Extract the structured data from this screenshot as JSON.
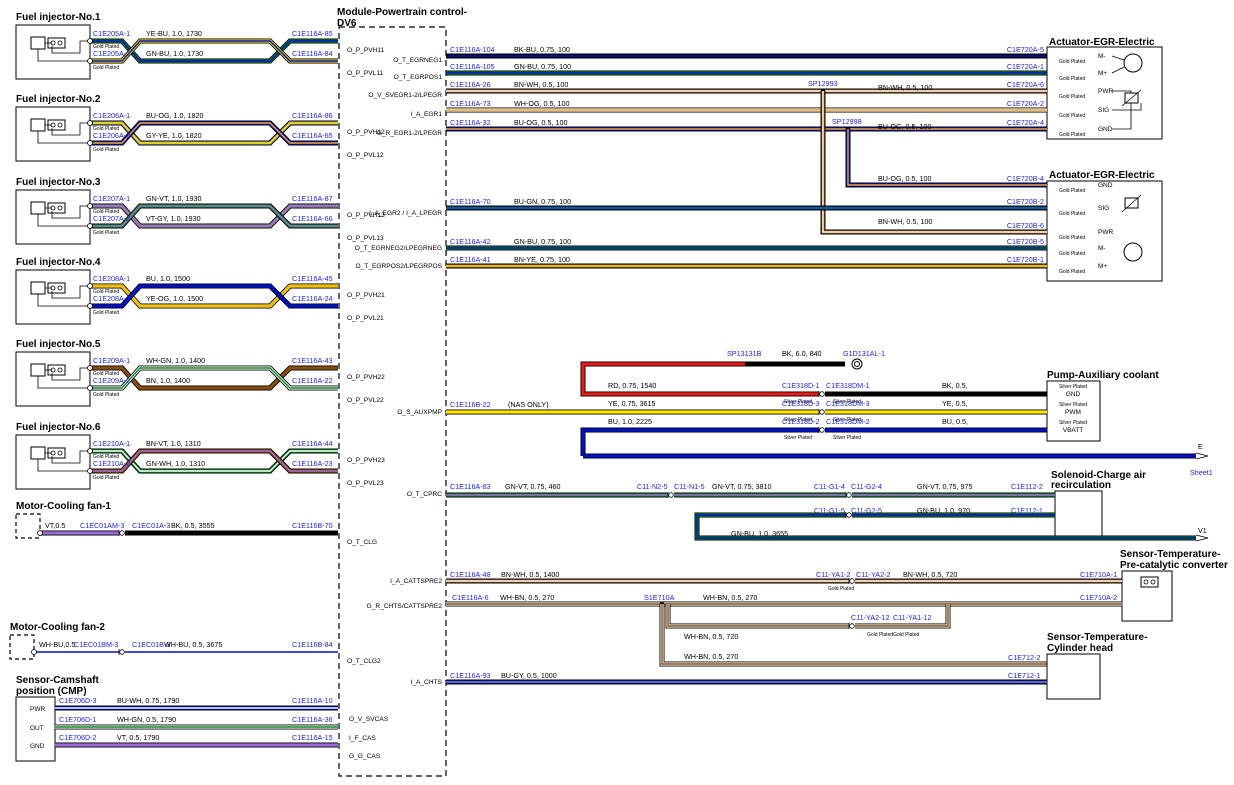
{
  "module": {
    "title": "Module-Powertrain control-DV6"
  },
  "colors": {
    "connector_text": "#1f1fd6",
    "BK": "#000000",
    "YE": "#ffe600",
    "BU": "#0010c8",
    "GN": "#0a8a25",
    "WH": "#ffffff",
    "OG": "#f5a623",
    "GY": "#8a8a8a",
    "VT": "#a06ad8",
    "BN": "#8a4d0c",
    "RD": "#e81b1b"
  },
  "plating": {
    "gold": "Gold Plated",
    "silver": "Silver Plated",
    "gold_gold": "Gold PlatedGold Plated"
  },
  "injectors": [
    {
      "title": "Fuel injector-No.1",
      "c1": "C1E205A-1",
      "c2": "C1E205A-2",
      "w1": "YE-BU,  1.0,  1730",
      "w2": "GN-BU,  1.0,  1730",
      "m1": "C1E116A-85",
      "m2": "C1E116A-84",
      "s1": "O_P_PVH11",
      "s2": "O_P_PVL11"
    },
    {
      "title": "Fuel injector-No.2",
      "c1": "C1E206A-1",
      "c2": "C1E206A-2",
      "w1": "BU-OG,  1.0,  1820",
      "w2": "GY-YE,  1.0,  1820",
      "m1": "C1E116A-86",
      "m2": "C1E116A-65",
      "s1": "O_P_PVH12",
      "s2": "O_P_PVL12"
    },
    {
      "title": "Fuel injector-No.3",
      "c1": "C1E207A-1",
      "c2": "C1E207A-2",
      "w1": "GN-VT,  1.0,  1930",
      "w2": "VT-GY,  1.0,  1930",
      "m1": "C1E116A-87",
      "m2": "C1E116A-66",
      "s1": "O_P_PVH13",
      "s2": "O_P_PVL13"
    },
    {
      "title": "Fuel injector-No.4",
      "c1": "C1E208A-1",
      "c2": "C1E208A-2",
      "w1": "BU,  1.0,  1500",
      "w2": "YE-OG,  1.0,  1500",
      "m1": "C1E116A-45",
      "m2": "C1E116A-24",
      "s1": "O_P_PVH21",
      "s2": "O_P_PVL21"
    },
    {
      "title": "Fuel injector-No.5",
      "c1": "C1E209A-1",
      "c2": "C1E209A-2",
      "w1": "WH-GN,  1.0,  1400",
      "w2": "BN,  1.0,  1400",
      "m1": "C1E116A-43",
      "m2": "C1E116A-22",
      "s1": "O_P_PVH22",
      "s2": "O_P_PVL22"
    },
    {
      "title": "Fuel injector-No.6",
      "c1": "C1E210A-1",
      "c2": "C1E210A-2",
      "w1": "BN-VT,  1.0,  1310",
      "w2": "GN-WH,  1.0,  1310",
      "m1": "C1E116A-44",
      "m2": "C1E116A-23",
      "s1": "O_P_PVH23",
      "s2": "O_P_PVL23"
    }
  ],
  "fan1": {
    "title": "Motor-Cooling fan-1",
    "pre": "VT,0.5",
    "c_a": "C1EC01AM-3",
    "c_b": "C1EC01A-3",
    "wire": "BK,  0.5,  3555",
    "m": "C1E116B-70",
    "sig": "O_T_CLG"
  },
  "fan2": {
    "title": "Motor-Cooling fan-2",
    "pre": "WH-BU,0.5",
    "c_a": "C1EC01BM-3",
    "c_b": "C1EC01B-3",
    "wire": "WH-BU,  0.5,  3675",
    "m": "C1E116B-84",
    "sig": "O_T_CLG2"
  },
  "cmp": {
    "title1": "Sensor-Camshaft",
    "title2": "position (CMP)",
    "pins": [
      "PWR",
      "OUT",
      "GND"
    ],
    "rows": [
      {
        "c": "C1E706D-3",
        "w": "BU-WH,  0.75,  1790",
        "m": "C1E116A-10",
        "s": "O_V_SVCAS"
      },
      {
        "c": "C1E706D-1",
        "w": "WH-GN,  0.5,  1790",
        "m": "C1E116A-36",
        "s": "I_F_CAS"
      },
      {
        "c": "C1E706D-2",
        "w": "VT,  0.5,  1790",
        "m": "C1E116A-15",
        "s": "G_G_CAS"
      }
    ]
  },
  "egr1": {
    "title": "Actuator-EGR-Electric",
    "pins": [
      "M-",
      "M+",
      "PWR",
      "SIG",
      "GND"
    ],
    "rows": [
      {
        "m": "C1E116A-104",
        "s": "O_T_EGRNEG1",
        "w": "BK-BU,  0.75,  100",
        "c": "C1E720A-5"
      },
      {
        "m": "C1E116A-105",
        "s": "O_T_EGRPOS1",
        "w": "GN-BU,  0.75,  100",
        "c": "C1E720A-1"
      },
      {
        "m": "C1E116A-26",
        "s": "O_V_SVEGR1-2/LPEGR",
        "w": "BN-WH,  0.5,  100",
        "c": "C1E720A-6"
      },
      {
        "m": "C1E116A-73",
        "s": "I_A_EGR1",
        "w": "WH-OG,  0.5,  100",
        "c": "C1E720A-2"
      },
      {
        "m": "C1E116A-32",
        "s": "G_R_EGR1-2/LPEGR",
        "w": "BU-OG,  0.5,  100",
        "c": "C1E720A-4"
      }
    ],
    "splice1": "SP12993",
    "splice2": "SP12998",
    "w_sp1": "BN-WH,  0.5,  100",
    "w_sp2": "BU-OG,  0.5,  100"
  },
  "egr2": {
    "title": "Actuator-EGR-Electric",
    "pins": [
      "GND",
      "SIG",
      "PWR",
      "M-",
      "M+"
    ],
    "c": [
      "C1E720B-4",
      "C1E720B-2",
      "C1E720B-6",
      "C1E720B-5",
      "C1E720B-1"
    ],
    "w_gnd": "BU-OG,  0.5,  100",
    "w_sig": "BU-GN,  0.75,  100",
    "w_pwr": "BN-WH,  0.5,  100",
    "w_mneg": "GN-BU,  0.75,  100",
    "w_mpos": "BN-YE,  0.75,  100",
    "m_sig": "C1E116A-70",
    "s_sig": "I_A_EGR2 / I_A_LPEGR",
    "m_neg": "C1E116A-42",
    "s_neg": "O_T_EGRNEG2/LPEGRNEG",
    "m_pos": "C1E116A-41",
    "s_pos": "O_T_EGRPOS2/LPEGRPOS"
  },
  "pump": {
    "title": "Pump-Auxiliary coolant",
    "pins": [
      "GND",
      "PWM",
      "VBATT"
    ],
    "splice": "SP13131B",
    "gnd_wire": "BK,  6.0,  840",
    "ground": "G1D131AL-1",
    "rd_wire": "RD,  0.75,  1540",
    "ye_wire": "YE,  0.75,  3615",
    "bu_wire": "BU,  1.0,  2225",
    "m": "C1E116B-22",
    "nas": "(NAS ONLY)",
    "s": "O_S_AUXPMP",
    "c_d": [
      "C1E318D-1",
      "C1E318D-3",
      "C1E318D-2"
    ],
    "c_dm": [
      "C1E318DM-1",
      "C1E318DM-3",
      "C1E318DM-2"
    ],
    "w_right": [
      "BK,  0.5,",
      "YE,  0.5,",
      "BU,  0.5,"
    ],
    "ref_letter": "E",
    "ref_sheet": "Sheet1"
  },
  "solenoid": {
    "title1": "Solenoid-Charge air",
    "title2": "recirculation",
    "m": "C1E116A-83",
    "s": "O_T_CPRC",
    "w1": "GN-VT,  0.75,  460",
    "n2_5": "C11-N2-5",
    "n1_5": "C11-N1-5",
    "w2": "GN-VT,  0.75,  3810",
    "g1_4": "C11-G1-4",
    "g2_4": "C11-G2-4",
    "w3": "GN-VT,  0.75,  975",
    "c_top": "C1E112-2",
    "g1_5": "C11-G1-5",
    "g2_5": "C11-G2-5",
    "w4": "GN-BU,  1.0,  970",
    "c_bot": "C1E112-1",
    "w5": "GN-BU,  1.0,  3655",
    "ref": "V1"
  },
  "temp_pre": {
    "title1": "Sensor-Temperature-",
    "title2": "Pre-catalytic converter",
    "m1": "C1E116A-48",
    "s1": "I_A_CATTSPRE2",
    "w1": "BN-WH,  0.5,  1400",
    "ya1_2": "C11-YA1-2",
    "ya2_2": "C11-YA2-2",
    "w2": "BN-WH,  0.5,  720",
    "c1": "C1E710A-1",
    "m2": "C1E116A-6",
    "s2": "G_R_CHTS/CATTSPRE2",
    "w3": "WH-BN,  0.5,  270",
    "splice": "S1E710A",
    "w4": "WH-BN,  0.5,  270",
    "c2": "C1E710A-2",
    "ya2_12": "C11-YA2-12",
    "ya1_12": "C11-YA1-12",
    "w5": "WH-BN,  0.5,  720",
    "w6": "WH-BN,  0.5,  270"
  },
  "temp_head": {
    "title1": "Sensor-Temperature-",
    "title2": "Cylinder head",
    "c1": "C1E712-2",
    "m": "C1E116A-93",
    "s": "I_A_CHTS",
    "w": "BU-GY,  0.5,  1000",
    "c2": "C1E712-1"
  }
}
